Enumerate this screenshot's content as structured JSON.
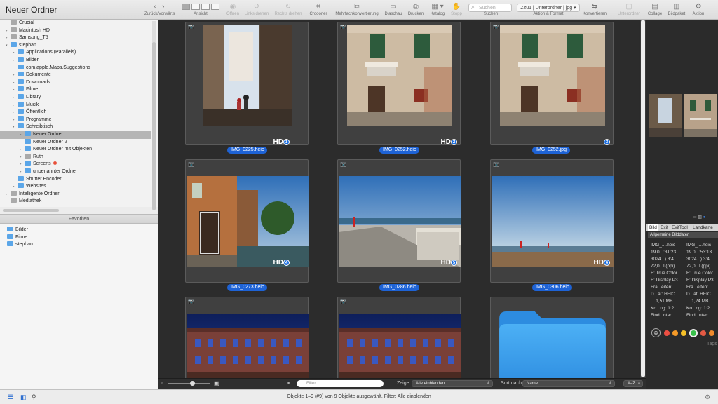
{
  "window": {
    "title": "Neuer Ordner"
  },
  "toolbar": {
    "back_label": "Zurück/Vorwärts",
    "view_label": "Ansicht",
    "open_label": "Öffnen",
    "rotate_left_label": "Links drehen",
    "rotate_right_label": "Rechts drehen",
    "crop_label": "Croooner",
    "batch_label": "Mehrfachkonvertierung",
    "slideshow_label": "Diaschau",
    "print_label": "Drucken",
    "catalog_label": "Katalog",
    "stop_label": "Stopp",
    "search_placeholder": "Suchen",
    "search_label": "Suchen",
    "path_value": "Zzu1 | Unterordner | jpg",
    "action_format_label": "Aktion & Format",
    "convert_label": "Konvertieren",
    "sub_label": "Unterordner",
    "collage_label": "Collage",
    "image_package_label": "Bildpaket",
    "action_label": "Aktion"
  },
  "tree": [
    {
      "label": "Crucial",
      "indent": 0,
      "arrow": "",
      "color": "gray"
    },
    {
      "label": "Macintosh HD",
      "indent": 0,
      "arrow": "▸",
      "color": "gray"
    },
    {
      "label": "Samsung_T5",
      "indent": 0,
      "arrow": "▸",
      "color": "gray"
    },
    {
      "label": "stephan",
      "indent": 0,
      "arrow": "▾",
      "color": "blue"
    },
    {
      "label": "Applications (Parallels)",
      "indent": 1,
      "arrow": "▸",
      "color": "blue"
    },
    {
      "label": "Bilder",
      "indent": 1,
      "arrow": "▸",
      "color": "blue"
    },
    {
      "label": "com.apple.Maps.Suggestions",
      "indent": 1,
      "arrow": "",
      "color": "blue"
    },
    {
      "label": "Dokumente",
      "indent": 1,
      "arrow": "▸",
      "color": "blue"
    },
    {
      "label": "Downloads",
      "indent": 1,
      "arrow": "▸",
      "color": "blue"
    },
    {
      "label": "Filme",
      "indent": 1,
      "arrow": "▸",
      "color": "blue"
    },
    {
      "label": "Library",
      "indent": 1,
      "arrow": "▸",
      "color": "blue"
    },
    {
      "label": "Musik",
      "indent": 1,
      "arrow": "▸",
      "color": "blue"
    },
    {
      "label": "Öffentlich",
      "indent": 1,
      "arrow": "▸",
      "color": "blue"
    },
    {
      "label": "Programme",
      "indent": 1,
      "arrow": "▸",
      "color": "blue"
    },
    {
      "label": "Schreibtisch",
      "indent": 1,
      "arrow": "▾",
      "color": "blue"
    },
    {
      "label": "Neuer Ordner",
      "indent": 2,
      "arrow": "▸",
      "color": "blue",
      "selected": true
    },
    {
      "label": "Neuer Ordner 2",
      "indent": 2,
      "arrow": "",
      "color": "blue"
    },
    {
      "label": "Neuer Ordner mit Objekten",
      "indent": 2,
      "arrow": "▸",
      "color": "blue"
    },
    {
      "label": "Ruth",
      "indent": 2,
      "arrow": "▸",
      "color": "gray"
    },
    {
      "label": "Screens",
      "indent": 2,
      "arrow": "▸",
      "color": "blue",
      "dot": true
    },
    {
      "label": "unbenannter Ordner",
      "indent": 2,
      "arrow": "▸",
      "color": "blue"
    },
    {
      "label": "Shutter Encoder",
      "indent": 1,
      "arrow": "",
      "color": "blue"
    },
    {
      "label": "Websites",
      "indent": 1,
      "arrow": "▸",
      "color": "blue"
    },
    {
      "label": "Intelligente Ordner",
      "indent": 0,
      "arrow": "▸",
      "color": "gray"
    },
    {
      "label": "Mediathek",
      "indent": 0,
      "arrow": "",
      "color": "gray"
    }
  ],
  "favorites": {
    "title": "Favoriten",
    "items": [
      "Bilder",
      "Filme",
      "stephan"
    ]
  },
  "grid": [
    {
      "file": "IMG_0225.heic",
      "hd": "HD",
      "badge": "1"
    },
    {
      "file": "IMG_0252.heic",
      "hd": "HD",
      "badge": "2"
    },
    {
      "file": "IMG_0252.jpg",
      "hd": "",
      "badge": "3"
    },
    {
      "file": "IMG_0273.heic",
      "hd": "HD",
      "badge": "4"
    },
    {
      "file": "IMG_0286.heic",
      "hd": "HD",
      "badge": "5"
    },
    {
      "file": "IMG_0306.heic",
      "hd": "HD",
      "badge": "6"
    },
    {
      "file": "",
      "hd": "",
      "badge": ""
    },
    {
      "file": "",
      "hd": "",
      "badge": ""
    },
    {
      "file": "",
      "hd": "",
      "badge": ""
    }
  ],
  "mainbar": {
    "filter_placeholder": "Filter",
    "show_label": "Zeige:",
    "show_value": "Alle einblenden",
    "sort_label": "Sort nach:",
    "sort_value": "Name",
    "order_value": "A–Z"
  },
  "rpanel": {
    "tabs": [
      "Bild",
      "Exif",
      "ExifTool",
      "Landkarte"
    ],
    "general_label": "Allgemeine Bilddaten",
    "col1": [
      "IMG_....heic",
      "19.0...:31:23",
      "3024...) 3:4",
      "72,0...l (ppi)",
      "F: True Color",
      "F: Display P3",
      "Fra...eiten:",
      "D...at: HEIC",
      "... 1,51 MB",
      "Ko...ng: 1:2",
      "Find...ntar:"
    ],
    "col2": [
      "IMG_....heic",
      "19.0...:53:13",
      "3024...) 3:4",
      "72,0...l (ppi)",
      "F: True Color",
      "F: Display P3",
      "Fra...eiten:",
      "D...at: HEIC",
      "... 1,24 MB",
      "Ko...ng: 1:2",
      "Find...ntar:"
    ],
    "tags_label": "Tags"
  },
  "status": {
    "text": "Objekte 1–9 (#9) von 9 Objekte ausgewählt, Filter: Alle einblenden"
  }
}
